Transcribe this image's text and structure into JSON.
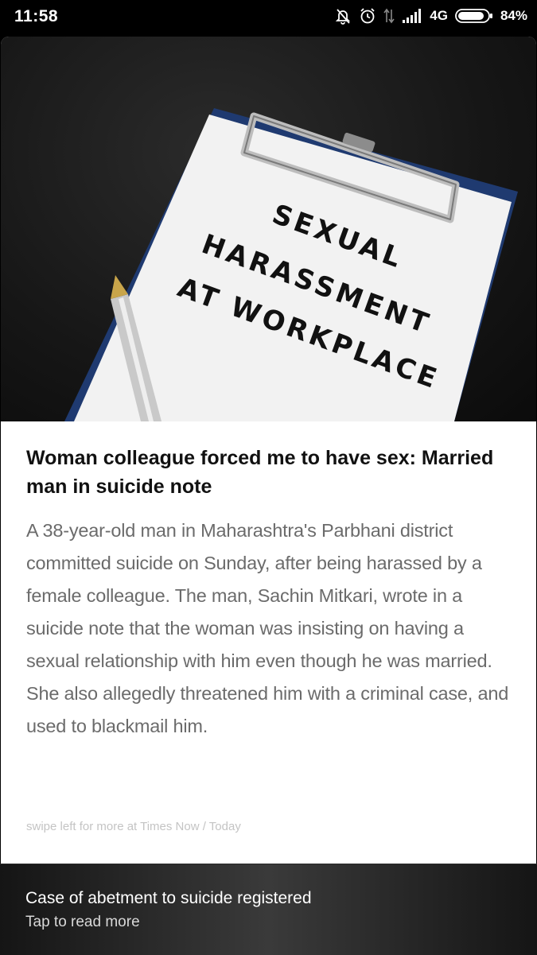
{
  "status_bar": {
    "time": "11:58",
    "network": "4G",
    "battery": "84%",
    "icons": [
      "mute-bell-icon",
      "alarm-icon",
      "data-arrows-icon",
      "signal-icon",
      "battery-icon"
    ]
  },
  "article": {
    "image_text": [
      "SEXUAL",
      "HARASSMENT",
      "AT WORKPLACE"
    ],
    "headline": "Woman colleague forced me to have sex: Married man in suicide note",
    "summary": "A 38-year-old man in Maharashtra's Parbhani district committed suicide on Sunday, after being harassed by a female colleague. The man, Sachin Mitkari, wrote in a suicide note that the woman was insisting on having a sexual relationship with him even though he was married. She also allegedly threatened him with a criminal case, and used to blackmail him.",
    "source": "swipe left for more at Times Now / Today"
  },
  "bottom_bar": {
    "title": "Case of abetment to suicide registered",
    "subtitle": "Tap to read more"
  },
  "colors": {
    "headline": "#111111",
    "summary": "#6b6b6b",
    "source": "#c4c4c4",
    "status_bar": "#000000"
  }
}
